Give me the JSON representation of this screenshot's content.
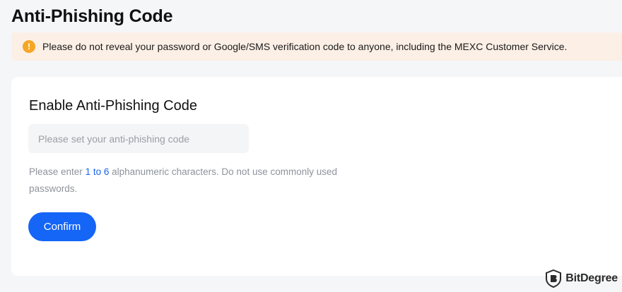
{
  "page": {
    "title": "Anti-Phishing Code"
  },
  "notice": {
    "icon": "warning-icon",
    "text": "Please do not reveal your password or Google/SMS verification code to anyone, including the MEXC Customer Service.",
    "background": "#fcefe6",
    "icon_color": "#f5a623"
  },
  "form": {
    "title": "Enable Anti-Phishing Code",
    "input_placeholder": "Please set your anti-phishing code",
    "input_value": "",
    "hint_prefix": "Please enter ",
    "hint_highlight": "1 to 6",
    "hint_suffix": " alphanumeric characters. Do not use commonly used passwords.",
    "confirm_label": "Confirm",
    "accent_color": "#1565f6"
  },
  "watermark": {
    "icon": "bitdegree-logo-icon",
    "text": "BitDegree"
  }
}
